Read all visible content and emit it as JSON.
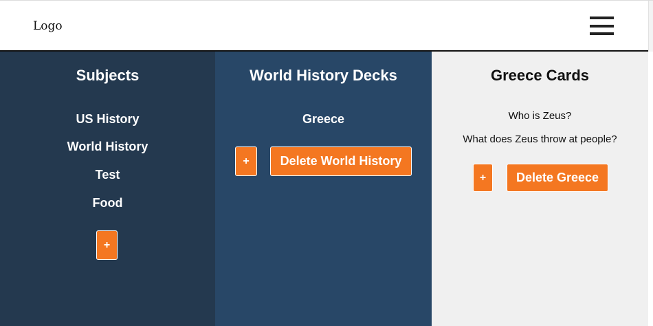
{
  "header": {
    "logo": "Logo",
    "menu_icon": "hamburger-menu-icon"
  },
  "subjects": {
    "title": "Subjects",
    "items": [
      "US History",
      "World History",
      "Test",
      "Food"
    ],
    "add_label": "+"
  },
  "decks": {
    "title": "World History Decks",
    "items": [
      "Greece"
    ],
    "add_label": "+",
    "delete_label": "Delete World History"
  },
  "cards": {
    "title": "Greece Cards",
    "items": [
      "Who is Zeus?",
      "What does Zeus throw at people?"
    ],
    "add_label": "+",
    "delete_label": "Delete Greece"
  },
  "colors": {
    "subjects_bg": "#24394f",
    "decks_bg": "#284767",
    "cards_bg": "#f0f0f0",
    "accent": "#f47721"
  }
}
